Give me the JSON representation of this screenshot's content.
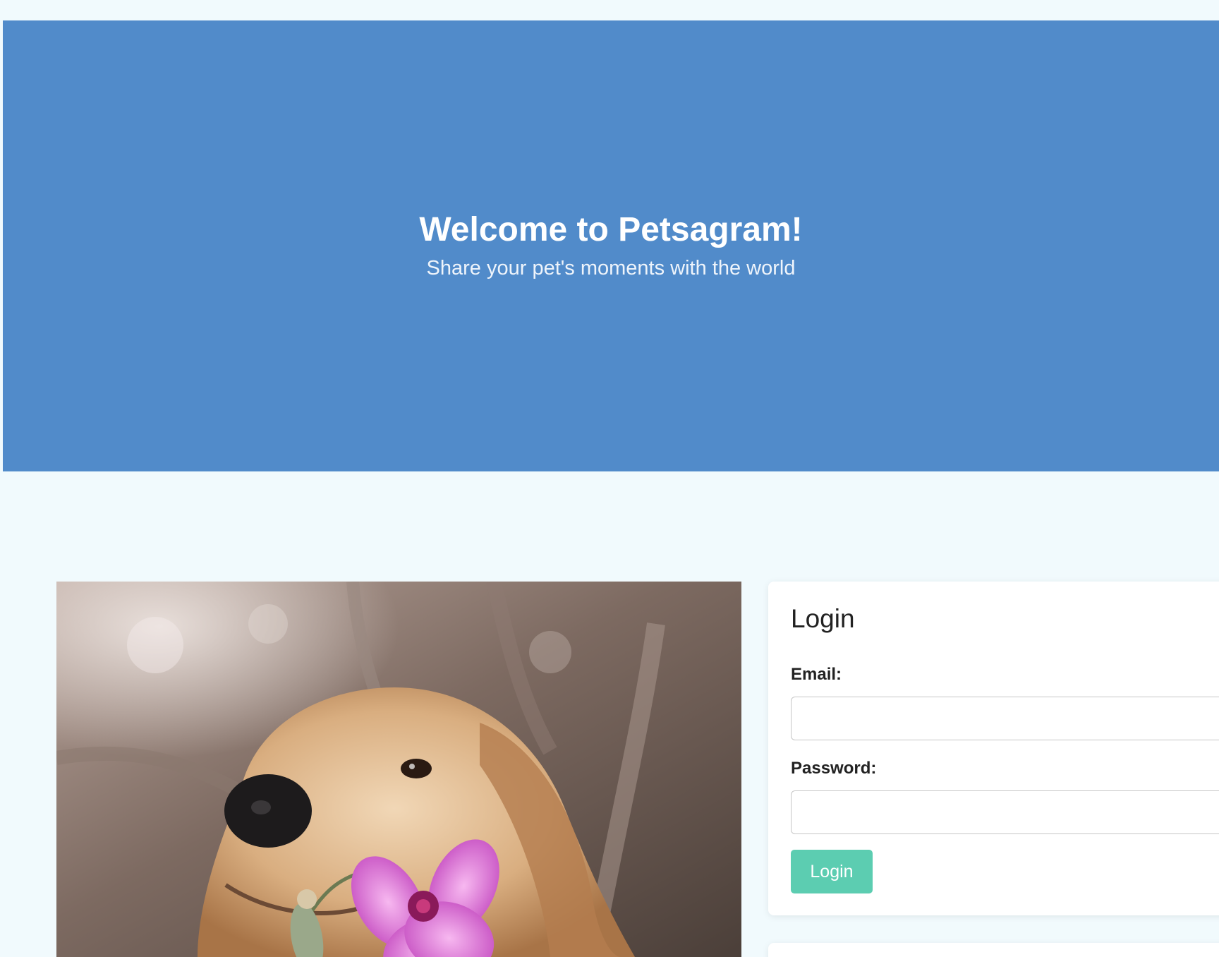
{
  "hero": {
    "title": "Welcome to Petsagram!",
    "subtitle": "Share your pet's moments with the world",
    "background_color": "#518bca"
  },
  "photo": {
    "alt": "Golden retriever holding a pink flower in its mouth"
  },
  "login": {
    "title": "Login",
    "email_label": "Email:",
    "email_value": "",
    "password_label": "Password:",
    "password_value": "",
    "button_label": "Login",
    "button_color": "#5ccdb1"
  },
  "colors": {
    "page_background": "#f1fafd",
    "card_background": "#ffffff"
  }
}
